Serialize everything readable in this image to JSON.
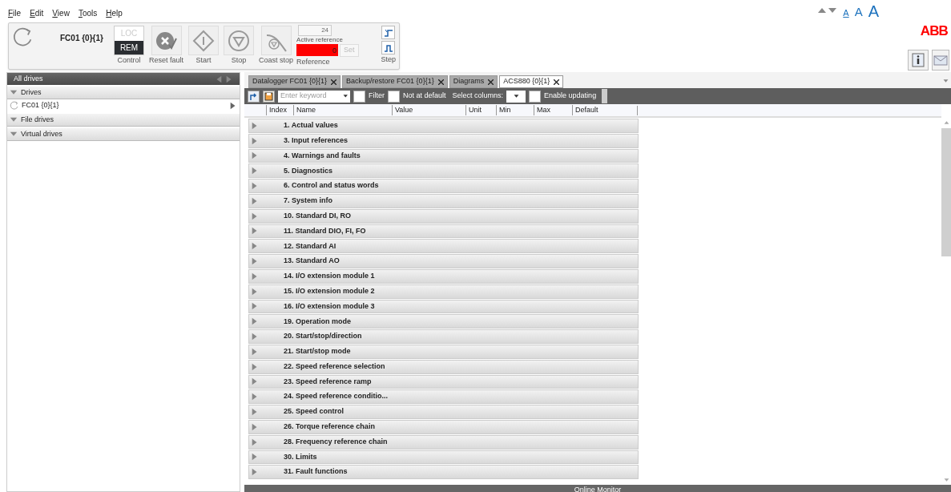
{
  "menu": [
    "File",
    "Edit",
    "View",
    "Tools",
    "Help"
  ],
  "font_sizes": [
    {
      "label": "A",
      "selected": true
    },
    {
      "label": "A",
      "selected": false
    },
    {
      "label": "A",
      "selected": false
    }
  ],
  "logo": "ABB",
  "drive_toolbar": {
    "drive": "FC01 {0}{1}",
    "control": {
      "options": [
        {
          "label": "LOC",
          "selected": false
        },
        {
          "label": "REM",
          "selected": true
        }
      ],
      "caption": "Control"
    },
    "buttons": [
      {
        "kind": "reset",
        "label": "Reset fault"
      },
      {
        "kind": "start",
        "label": "Start"
      },
      {
        "kind": "stop",
        "label": "Stop"
      },
      {
        "kind": "coast",
        "label": "Coast stop"
      }
    ],
    "active_reference": {
      "value": "24",
      "label": "Active reference",
      "reference": "0",
      "set": "Set",
      "caption": "Reference"
    },
    "step": "Step"
  },
  "sidebar": {
    "title": "All drives",
    "groups": [
      {
        "label": "Drives",
        "expanded": true,
        "items": [
          {
            "label": "FC01 {0}{1}",
            "selected": true
          }
        ]
      },
      {
        "label": "File drives",
        "expanded": true
      },
      {
        "label": "Virtual drives",
        "expanded": true
      }
    ]
  },
  "tabs": [
    {
      "label": "Datalogger FC01 {0}{1}",
      "selected": false
    },
    {
      "label": "Backup/restore FC01 {0}{1}",
      "selected": false
    },
    {
      "label": "Diagrams",
      "selected": false
    },
    {
      "label": "ACS880 {0}{1}",
      "selected": true
    }
  ],
  "params_toolbar": {
    "search": {
      "placeholder": "Enter keyword"
    },
    "filter": {
      "label": "Filter",
      "checked": false
    },
    "not_at_default": {
      "label": "Not at default",
      "checked": false
    },
    "select_columns": "Select columns:",
    "enable_updating": {
      "label": "Enable updating",
      "checked": false
    }
  },
  "table": {
    "columns": [
      "Index",
      "Name",
      "Value",
      "Unit",
      "Min",
      "Max",
      "Default"
    ],
    "groups": [
      "1. Actual values",
      "3. Input references",
      "4. Warnings and faults",
      "5. Diagnostics",
      "6. Control and status words",
      "7. System info",
      "10. Standard DI, RO",
      "11. Standard DIO, FI, FO",
      "12. Standard AI",
      "13. Standard AO",
      "14. I/O extension module 1",
      "15. I/O extension module 2",
      "16. I/O extension module 3",
      "19. Operation mode",
      "20. Start/stop/direction",
      "21. Start/stop mode",
      "22. Speed reference selection",
      "23. Speed reference ramp",
      "24. Speed reference conditio...",
      "25. Speed control",
      "26. Torque reference chain",
      "28. Frequency reference chain",
      "30. Limits",
      "31. Fault functions"
    ]
  },
  "bottom_panel": {
    "title": "Online Monitor"
  }
}
